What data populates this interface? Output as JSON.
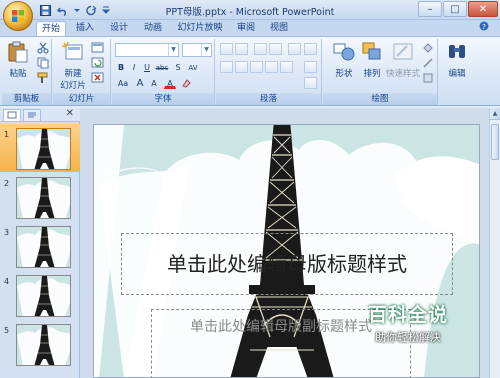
{
  "window": {
    "title": "PPT母版.pptx - Microsoft PowerPoint"
  },
  "tabs": [
    {
      "label": "开始",
      "active": true
    },
    {
      "label": "插入",
      "active": false
    },
    {
      "label": "设计",
      "active": false
    },
    {
      "label": "动画",
      "active": false
    },
    {
      "label": "幻灯片放映",
      "active": false
    },
    {
      "label": "审阅",
      "active": false
    },
    {
      "label": "视图",
      "active": false
    }
  ],
  "ribbon": {
    "clipboard": {
      "label": "剪贴板",
      "paste": "粘贴"
    },
    "slides": {
      "label": "幻灯片",
      "new_slide_line1": "新建",
      "new_slide_line2": "幻灯片"
    },
    "font": {
      "label": "字体",
      "size_shrink": "A",
      "size_grow": "A",
      "bold": "B",
      "italic": "I",
      "underline": "U",
      "strike": "abc",
      "shadow": "S",
      "spacing": "AV",
      "case": "Aa",
      "color": "A"
    },
    "paragraph": {
      "label": "段落"
    },
    "drawing": {
      "label": "绘图",
      "shapes": "形状",
      "arrange": "排列",
      "quick_styles": "快速样式"
    },
    "editing": {
      "label": "编辑"
    }
  },
  "thumbnails": [
    {
      "num": "1",
      "selected": true
    },
    {
      "num": "2",
      "selected": false
    },
    {
      "num": "3",
      "selected": false
    },
    {
      "num": "4",
      "selected": false
    },
    {
      "num": "5",
      "selected": false
    }
  ],
  "slide": {
    "title_placeholder": "单击此处编辑母版标题样式",
    "subtitle_placeholder": "单击此处编辑母版副标题样式"
  },
  "watermark": {
    "line1": "百科全说",
    "line2": "助你轻松解决"
  },
  "colors": {
    "accent": "#15428b",
    "ribbon_bg": "#dbe7f6",
    "selection": "#f7b24a"
  }
}
